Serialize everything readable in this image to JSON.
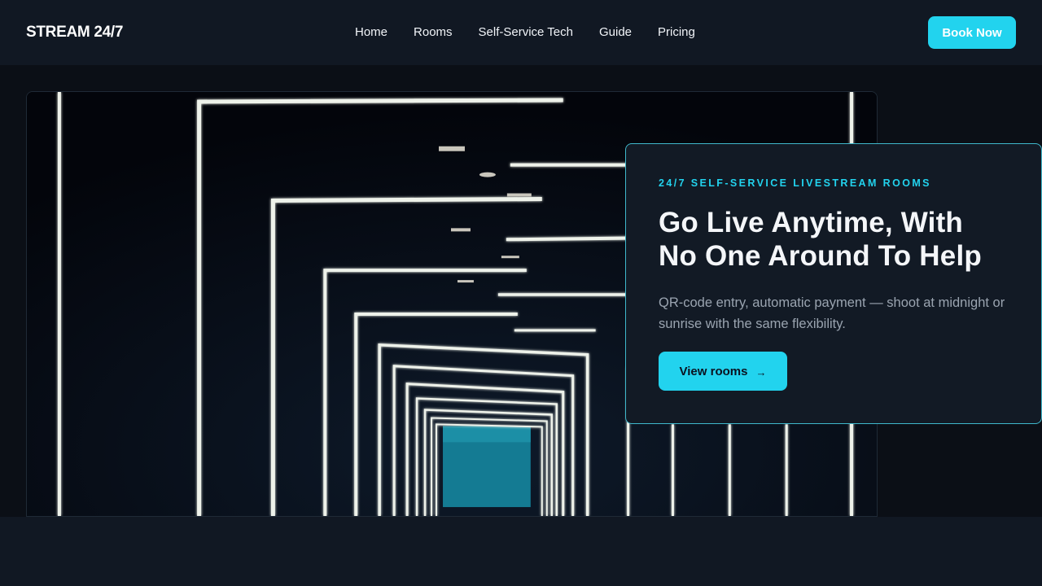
{
  "header": {
    "logo": "STREAM 24/7",
    "nav": [
      "Home",
      "Rooms",
      "Self-Service Tech",
      "Guide",
      "Pricing"
    ],
    "book_label": "Book Now"
  },
  "hero": {
    "eyebrow": "24/7 SELF-SERVICE LIVESTREAM ROOMS",
    "headline_line1": "Go Live Anytime, With",
    "headline_line2": "No One Around To Help",
    "subtext": "QR-code entry, automatic payment — shoot at midnight or sunrise with the same flexibility.",
    "cta_label": "View rooms",
    "cta_icon": "arrow-right-icon",
    "cta_glyph": "→"
  },
  "colors": {
    "accent": "#22d3ee",
    "background": "#111823",
    "card_border": "#3fb8cc"
  }
}
